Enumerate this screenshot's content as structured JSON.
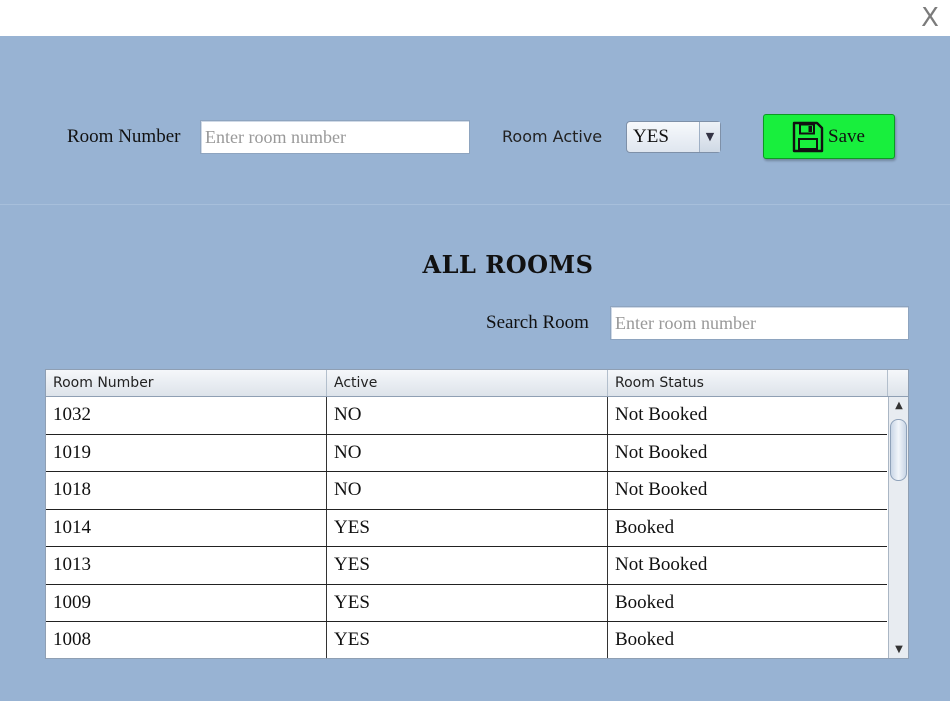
{
  "window": {
    "close_label": "X"
  },
  "form": {
    "room_number_label": "Room Number",
    "room_number_placeholder": "Enter room number",
    "room_active_label": "Room Active",
    "room_active_value": "YES",
    "save_label": "Save",
    "save_button_color": "#18ef3d"
  },
  "list": {
    "heading": "ALL ROOMS",
    "search_label": "Search Room",
    "search_placeholder": "Enter room number"
  },
  "table": {
    "columns": [
      "Room Number",
      "Active",
      "Room Status"
    ],
    "rows": [
      [
        "1032",
        "NO",
        "Not Booked"
      ],
      [
        "1019",
        "NO",
        "Not Booked"
      ],
      [
        "1018",
        "NO",
        "Not Booked"
      ],
      [
        "1014",
        "YES",
        "Booked"
      ],
      [
        "1013",
        "YES",
        "Not Booked"
      ],
      [
        "1009",
        "YES",
        "Booked"
      ],
      [
        "1008",
        "YES",
        "Booked"
      ]
    ]
  },
  "colors": {
    "panel_background": "#98b3d3"
  }
}
